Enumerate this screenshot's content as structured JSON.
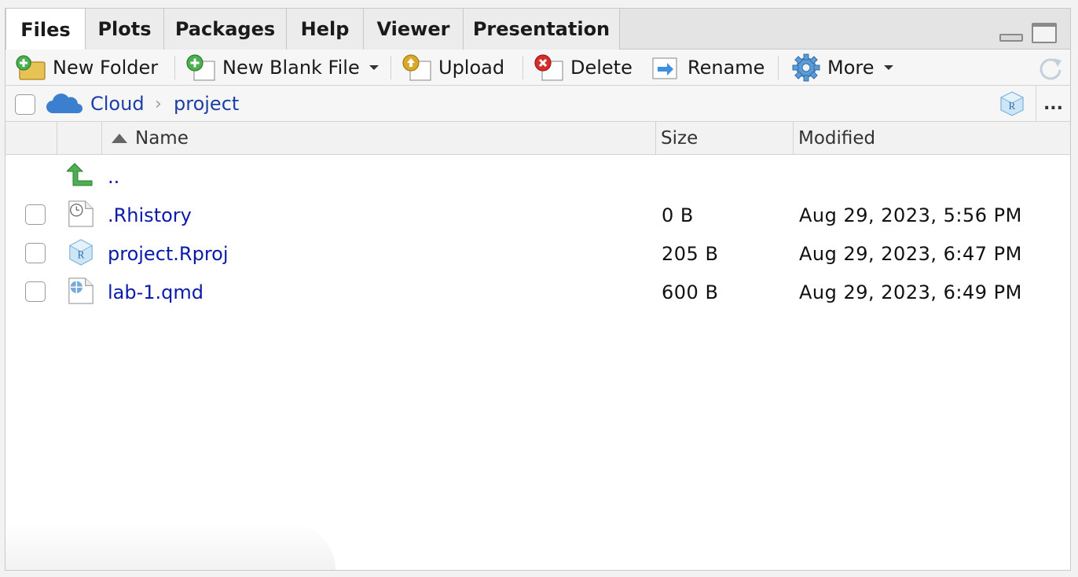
{
  "tabs": [
    {
      "label": "Files",
      "active": true
    },
    {
      "label": "Plots",
      "active": false
    },
    {
      "label": "Packages",
      "active": false
    },
    {
      "label": "Help",
      "active": false
    },
    {
      "label": "Viewer",
      "active": false
    },
    {
      "label": "Presentation",
      "active": false
    }
  ],
  "toolbar": {
    "new_folder": "New Folder",
    "new_blank_file": "New Blank File",
    "upload": "Upload",
    "delete": "Delete",
    "rename": "Rename",
    "more": "More"
  },
  "breadcrumb": {
    "root": "Cloud",
    "current": "project",
    "separator": "›",
    "overflow": "..."
  },
  "table": {
    "columns": {
      "name": "Name",
      "size": "Size",
      "modified": "Modified"
    },
    "sort": {
      "column": "Name",
      "direction": "ascending"
    },
    "parent_link": "..",
    "rows": [
      {
        "name": ".Rhistory",
        "size": "0 B",
        "modified": "Aug 29, 2023, 5:56 PM",
        "icon": "history-file-icon"
      },
      {
        "name": "project.Rproj",
        "size": "205 B",
        "modified": "Aug 29, 2023, 6:47 PM",
        "icon": "rproj-file-icon"
      },
      {
        "name": "lab-1.qmd",
        "size": "600 B",
        "modified": "Aug 29, 2023, 6:49 PM",
        "icon": "quarto-file-icon"
      }
    ]
  },
  "colors": {
    "link": "#0b1aa8",
    "breadcrumb_link": "#1b3fa8",
    "up_arrow": "#4caf50",
    "cloud": "#3d7fcf"
  }
}
